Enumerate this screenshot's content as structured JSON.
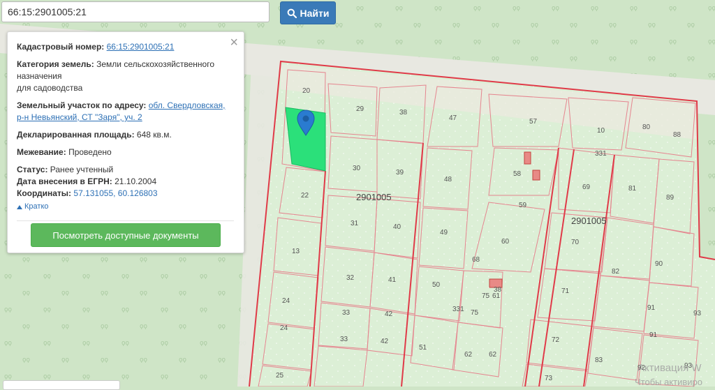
{
  "search": {
    "value": "66:15:2901005:21",
    "button_label": "Найти"
  },
  "info_panel": {
    "cadastral_number_label": "Кадастровый номер:",
    "cadastral_number_value": "66:15:2901005:21",
    "land_category_label": "Категория земель:",
    "land_category_value": "Земли сельскохозяйственного назначения",
    "land_use_value": "для садоводства",
    "address_label": "Земельный участок по адресу:",
    "address_value": "обл. Свердловская, р-н Невьянский, СТ \"Заря\", уч. 2",
    "area_label": "Декларированная площадь:",
    "area_value": "648 кв.м.",
    "survey_label": "Межевание:",
    "survey_value": "Проведено",
    "status_label": "Статус:",
    "status_value": "Ранее учтенный",
    "date_label": "Дата внесения в ЕГРН:",
    "date_value": "21.10.2004",
    "coords_label": "Координаты:",
    "coords_value": "57.131055, 60.126803",
    "collapse_label": "Кратко",
    "docs_button_label": "Посмотреть доступные документы"
  },
  "map": {
    "quarter_labels": [
      "2901005",
      "2901005"
    ],
    "parcel_labels": [
      "20",
      "29",
      "38",
      "47",
      "57",
      "10",
      "80",
      "88",
      "30",
      "39",
      "48",
      "58",
      "331",
      "69",
      "81",
      "89",
      "22",
      "31",
      "40",
      "49",
      "59",
      "60",
      "70",
      "13",
      "32",
      "41",
      "50",
      "68",
      "75",
      "61",
      "38",
      "71",
      "82",
      "90",
      "24",
      "33",
      "42",
      "331",
      "75",
      "91",
      "93",
      "24",
      "33",
      "42",
      "51",
      "62",
      "62",
      "72",
      "91",
      "25",
      "73",
      "83",
      "93",
      "92"
    ],
    "colors": {
      "background": "#cfe5c7",
      "road": "#e8e8e1",
      "parcel_fill": "#dcefd6",
      "parcel_line": "#e5858f",
      "boundary": "#e03a48",
      "selected": "#2be07a",
      "marker": "#2a7bd0"
    }
  },
  "watermark": {
    "line1": "Активация W",
    "line2": "Чтобы активиро"
  }
}
